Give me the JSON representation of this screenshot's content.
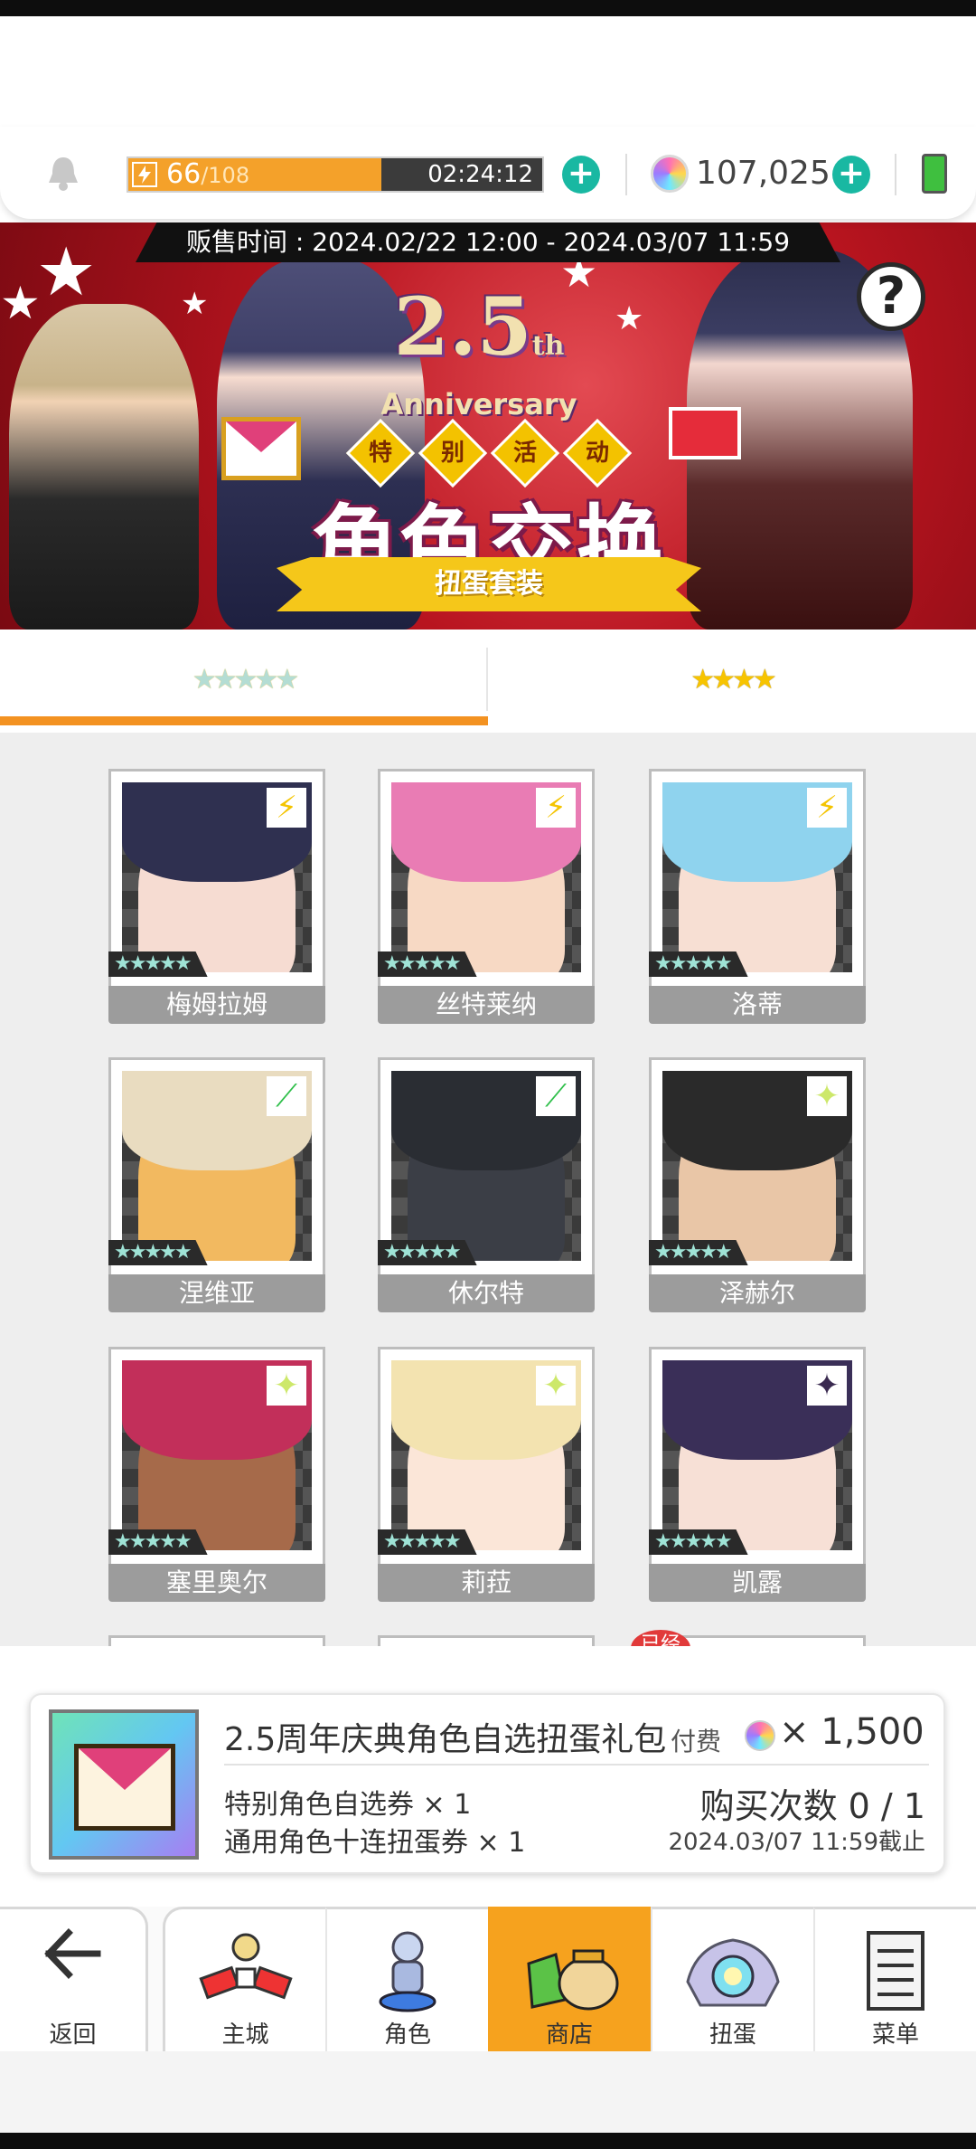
{
  "topbar": {
    "stamina_current": "66",
    "stamina_max": "/108",
    "stamina_fraction": 0.611,
    "timer": "02:24:12",
    "gem_amount": "107,025",
    "icons": [
      "bell-icon",
      "lightning-icon",
      "plus-icon",
      "gem-icon",
      "battery-icon"
    ]
  },
  "banner": {
    "sale_time": "贩售时间 : 2024.02/22 12:00 - 2024.03/07 11:59",
    "anniversary_number": "2.5",
    "anniversary_suffix": "th",
    "anniversary_word": "Anniversary",
    "event_tags": [
      "特",
      "别",
      "活",
      "动"
    ],
    "title": "角色交换",
    "subtitle": "扭蛋套装",
    "help_label": "?"
  },
  "tabs": [
    {
      "label": "★★★★★",
      "active": true
    },
    {
      "label": "★★★★",
      "active": false
    }
  ],
  "characters": [
    {
      "name": "梅姆拉姆",
      "stars": "★★★★★",
      "element": "lightning",
      "element_glyph": "⚡",
      "element_color": "#f4c400",
      "hair": "#2f3050",
      "skin": "#f6dcd2"
    },
    {
      "name": "丝特莱纳",
      "stars": "★★★★★",
      "element": "lightning",
      "element_glyph": "⚡",
      "element_color": "#f4c400",
      "hair": "#e97cb4",
      "skin": "#f7d9c4"
    },
    {
      "name": "洛蒂",
      "stars": "★★★★★",
      "element": "lightning",
      "element_glyph": "⚡",
      "element_color": "#f4c400",
      "hair": "#8fd3ee",
      "skin": "#f7dfd3"
    },
    {
      "name": "涅维亚",
      "stars": "★★★★★",
      "element": "wind",
      "element_glyph": "⟋",
      "element_color": "#2fbf4a",
      "hair": "#e9dcc0",
      "skin": "#f2b960"
    },
    {
      "name": "休尔特",
      "stars": "★★★★★",
      "element": "wind",
      "element_glyph": "⟋",
      "element_color": "#2fbf4a",
      "hair": "#2a2d33",
      "skin": "#3b3e46"
    },
    {
      "name": "泽赫尔",
      "stars": "★★★★★",
      "element": "light",
      "element_glyph": "✦",
      "element_color": "#cde86a",
      "hair": "#2a2a2a",
      "skin": "#e9c6a7"
    },
    {
      "name": "塞里奥尔",
      "stars": "★★★★★",
      "element": "light",
      "element_glyph": "✦",
      "element_color": "#cde86a",
      "hair": "#c22f5a",
      "skin": "#a66a4a"
    },
    {
      "name": "莉菈",
      "stars": "★★★★★",
      "element": "light",
      "element_glyph": "✦",
      "element_color": "#cde86a",
      "hair": "#f3e3b0",
      "skin": "#fbe6d8"
    },
    {
      "name": "凯露",
      "stars": "★★★★★",
      "element": "dark",
      "element_glyph": "✦",
      "element_color": "#3a2a50",
      "hair": "#3a2f58",
      "skin": "#f7e0d6"
    }
  ],
  "owned_badge": "已经",
  "product": {
    "name": "2.5周年庆典角色自选扭蛋礼包",
    "price_label": "付费",
    "price_value": "× 1,500",
    "items": [
      "特别角色自选券 × 1",
      "通用角色十连扭蛋券 × 1"
    ],
    "purchase_count": "购买次数 0 / 1",
    "deadline": "2024.03/07 11:59截止"
  },
  "nav": {
    "back": "返回",
    "home": "主城",
    "character": "角色",
    "shop": "商店",
    "gacha": "扭蛋",
    "menu": "菜单"
  },
  "colors": {
    "accent": "#f39221",
    "shop_active": "#f6a21e",
    "plus": "#19b8a2",
    "banner_red": "#b8141f"
  }
}
